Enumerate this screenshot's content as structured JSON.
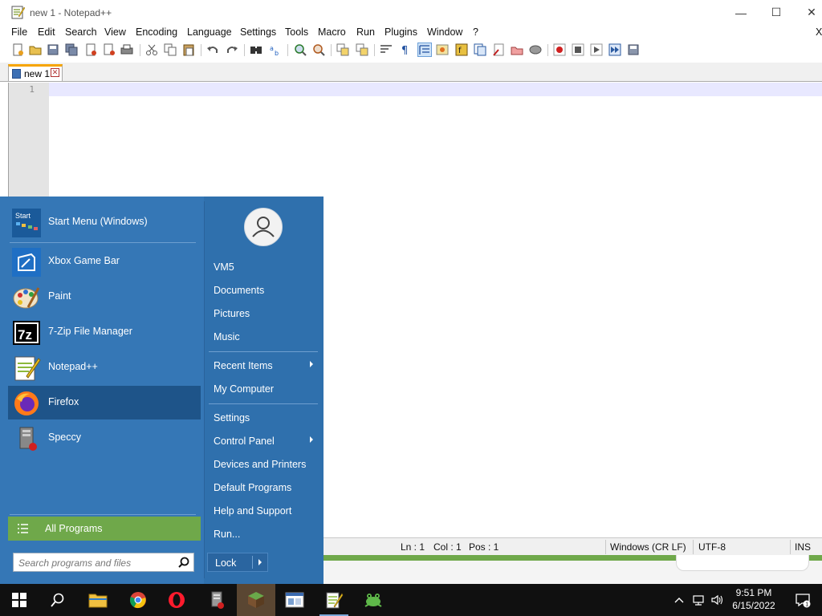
{
  "window": {
    "title": "new 1 - Notepad++",
    "minimize_glyph": "—",
    "maximize_glyph": "☐",
    "close_glyph": "✕"
  },
  "menu": [
    "File",
    "Edit",
    "Search",
    "View",
    "Encoding",
    "Language",
    "Settings",
    "Tools",
    "Macro",
    "Run",
    "Plugins",
    "Window",
    "?"
  ],
  "menu_close_glyph": "X",
  "tab": {
    "label": "new 1",
    "close_glyph": "✕"
  },
  "editor": {
    "line_numbers": [
      "1"
    ],
    "content": ""
  },
  "statusbar": {
    "ln": "Ln : 1",
    "col": "Col : 1",
    "pos": "Pos : 1",
    "eol": "Windows (CR LF)",
    "encoding": "UTF-8",
    "mode": "INS"
  },
  "startmenu": {
    "pinned": [
      {
        "label": "Start Menu (Windows)",
        "icon": "start-menu-icon"
      },
      {
        "label": "Xbox Game Bar",
        "icon": "xbox-game-bar-icon"
      },
      {
        "label": "Paint",
        "icon": "paint-icon"
      },
      {
        "label": "7-Zip File Manager",
        "icon": "7zip-icon"
      },
      {
        "label": "Notepad++",
        "icon": "notepadpp-icon"
      },
      {
        "label": "Firefox",
        "icon": "firefox-icon",
        "highlighted": true
      },
      {
        "label": "Speccy",
        "icon": "speccy-icon"
      }
    ],
    "start_icon_text": "Start",
    "sevenzip_icon_text": "7z",
    "all_programs": "All Programs",
    "search_placeholder": "Search programs and files",
    "user_links": [
      {
        "label": "VM5",
        "submenu": false
      },
      {
        "label": "Documents",
        "submenu": false
      },
      {
        "label": "Pictures",
        "submenu": false
      },
      {
        "label": "Music",
        "submenu": false
      },
      {
        "label": "Recent Items",
        "submenu": true
      },
      {
        "label": "My Computer",
        "submenu": false
      },
      {
        "label": "Settings",
        "submenu": false
      },
      {
        "label": "Control Panel",
        "submenu": true
      },
      {
        "label": "Devices and Printers",
        "submenu": false
      },
      {
        "label": "Default Programs",
        "submenu": false
      },
      {
        "label": "Help and Support",
        "submenu": false
      },
      {
        "label": "Run...",
        "submenu": false
      }
    ],
    "lock": "Lock"
  },
  "taskbar": {
    "apps": [
      {
        "name": "windows-start-icon"
      },
      {
        "name": "search-icon"
      },
      {
        "name": "file-explorer-icon"
      },
      {
        "name": "chrome-icon"
      },
      {
        "name": "opera-icon"
      },
      {
        "name": "speccy-taskbar-icon"
      },
      {
        "name": "minecraft-icon",
        "active": true
      },
      {
        "name": "window-app-icon"
      },
      {
        "name": "notepadpp-taskbar-icon",
        "running": true
      },
      {
        "name": "frog-app-icon"
      }
    ],
    "time": "9:51 PM",
    "date": "6/15/2022",
    "notification_count": "1"
  },
  "colors": {
    "startmenu_bg": "#2f70ad",
    "all_programs_bg": "#6fa84a",
    "highlight": "#1e5489",
    "taskbar_bg": "#101010",
    "tab_accent": "#f6a400"
  }
}
